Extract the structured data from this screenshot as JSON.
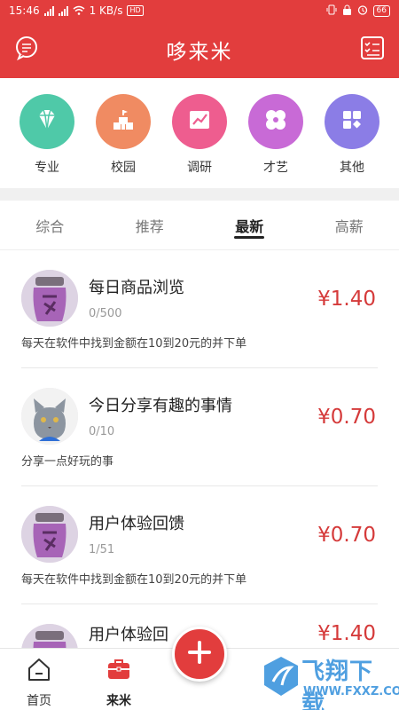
{
  "status_bar": {
    "time": "15:46",
    "network_speed": "1 KB/s",
    "hd_badge": "HD",
    "battery": "66"
  },
  "app_bar": {
    "title": "哆来米",
    "left_icon": "message-icon",
    "right_icon": "checklist-icon"
  },
  "categories": [
    {
      "label": "专业",
      "icon": "diamond-icon",
      "color": "#4fc9a8"
    },
    {
      "label": "校园",
      "icon": "campus-icon",
      "color": "#f08b62"
    },
    {
      "label": "调研",
      "icon": "chart-icon",
      "color": "#ee5d8f"
    },
    {
      "label": "才艺",
      "icon": "flower-icon",
      "color": "#c86ad6"
    },
    {
      "label": "其他",
      "icon": "grid-icon",
      "color": "#8b7de6"
    }
  ],
  "tabs": [
    {
      "label": "综合",
      "active": false
    },
    {
      "label": "推荐",
      "active": false
    },
    {
      "label": "最新",
      "active": true
    },
    {
      "label": "高薪",
      "active": false
    }
  ],
  "tasks": [
    {
      "title": "每日商品浏览",
      "count": "0/500",
      "price": "¥1.40",
      "description": "每天在软件中找到金额在10到20元的并下单",
      "avatar": "jar-image"
    },
    {
      "title": "今日分享有趣的事情",
      "count": "0/10",
      "price": "¥0.70",
      "description": "分享一点好玩的事",
      "avatar": "cat-image"
    },
    {
      "title": "用户体验回馈",
      "count": "1/51",
      "price": "¥0.70",
      "description": "每天在软件中找到金额在10到20元的并下单",
      "avatar": "jar-image"
    },
    {
      "title": "用户体验回",
      "count": "",
      "price": "¥1.40",
      "description": "",
      "avatar": "jar-image"
    }
  ],
  "bottom_nav": {
    "home_label": "首页",
    "laimi_label": "来米",
    "fab_icon": "plus-icon"
  },
  "watermark": {
    "text": "飞翔下载",
    "url": "WWW.FXXZ.COM"
  },
  "colors": {
    "brand_red": "#e23d3d",
    "price_red": "#d53a3a",
    "watermark_blue": "#4f9fe0"
  }
}
